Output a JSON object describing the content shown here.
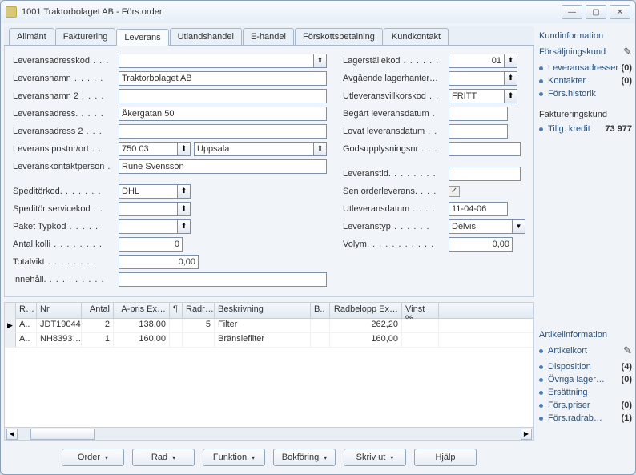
{
  "window": {
    "title": "1001 Traktorbolaget AB - Förs.order"
  },
  "tabs": [
    "Allmänt",
    "Fakturering",
    "Leverans",
    "Utlandshandel",
    "E-handel",
    "Förskottsbetalning",
    "Kundkontakt"
  ],
  "active_tab": 2,
  "left_fields": {
    "leveransadresskod": {
      "label": "Leveransadresskod",
      "value": ""
    },
    "leveransnamn": {
      "label": "Leveransnamn",
      "value": "Traktorbolaget AB"
    },
    "leveransnamn2": {
      "label": "Leveransnamn 2",
      "value": ""
    },
    "leveransadress": {
      "label": "Leveransadress.",
      "value": "Åkergatan 50"
    },
    "leveransadress2": {
      "label": "Leveransadress 2",
      "value": ""
    },
    "postnr": {
      "label": "Leverans postnr/ort",
      "value": "750 03"
    },
    "ort": {
      "value": "Uppsala"
    },
    "kontakt": {
      "label": "Leveranskontaktperson",
      "value": "Rune Svensson"
    },
    "speditor": {
      "label": "Speditörkod.",
      "value": "DHL"
    },
    "speditorservice": {
      "label": "Speditör servicekod",
      "value": ""
    },
    "pakettyp": {
      "label": "Paket Typkod",
      "value": ""
    },
    "antalkolli": {
      "label": "Antal kolli",
      "value": "0"
    },
    "totalvikt": {
      "label": "Totalvikt",
      "value": "0,00"
    },
    "innehall": {
      "label": "Innehåll.",
      "value": ""
    }
  },
  "right_fields": {
    "lagerstallekod": {
      "label": "Lagerställekod",
      "value": "01"
    },
    "avgaende": {
      "label": "Avgående lagerhanter…",
      "value": ""
    },
    "utleveransvillkor": {
      "label": "Utleveransvillkorskod",
      "value": "FRITT"
    },
    "begartdatum": {
      "label": "Begärt leveransdatum",
      "value": ""
    },
    "lovatdatum": {
      "label": "Lovat leveransdatum",
      "value": ""
    },
    "godsupplysning": {
      "label": "Godsupplysningsnr",
      "value": ""
    },
    "leveranstid": {
      "label": "Leveranstid.",
      "value": ""
    },
    "senorder": {
      "label": "Sen orderleverans.",
      "checked": true
    },
    "utleveransdatum": {
      "label": "Utleveransdatum",
      "value": "11-04-06"
    },
    "leveranstyp": {
      "label": "Leveranstyp",
      "value": "Delvis"
    },
    "volym": {
      "label": "Volym.",
      "value": "0,00"
    }
  },
  "grid": {
    "cols": [
      "R…",
      "Nr",
      "Antal",
      "A-pris Ex…",
      "¶",
      "Radr…",
      "Beskrivning",
      "B..",
      "Radbelopp Ex…",
      "Vinst %"
    ],
    "rows": [
      {
        "sel": "▶",
        "r": "A..",
        "nr": "JDT19044",
        "antal": "2",
        "apris": "138,00",
        "p": "",
        "radr": "5",
        "besk": "Filter",
        "b": "",
        "radbel": "262,20",
        "vinst": ""
      },
      {
        "sel": "",
        "r": "A..",
        "nr": "NH8393…",
        "antal": "1",
        "apris": "160,00",
        "p": "",
        "radr": "",
        "besk": "Bränslefilter",
        "b": "",
        "radbel": "160,00",
        "vinst": ""
      }
    ]
  },
  "footer": [
    "Order",
    "Rad",
    "Funktion",
    "Bokföring",
    "Skriv ut",
    "Hjälp"
  ],
  "kundinfo": {
    "title": "Kundinformation",
    "fk_title": "Försäljningskund",
    "items": [
      {
        "label": "Leveransadresser",
        "badge": "(0)"
      },
      {
        "label": "Kontakter",
        "badge": "(0)"
      },
      {
        "label": "Förs.historik",
        "badge": ""
      }
    ],
    "fakt_title": "Faktureringskund",
    "kredit_label": "Tillg. kredit",
    "kredit_value": "73 977"
  },
  "artikelinfo": {
    "title": "Artikelinformation",
    "ak_label": "Artikelkort",
    "items": [
      {
        "label": "Disposition",
        "badge": "(4)"
      },
      {
        "label": "Övriga lager…",
        "badge": "(0)"
      },
      {
        "label": "Ersättning",
        "badge": ""
      },
      {
        "label": "Förs.priser",
        "badge": "(0)"
      },
      {
        "label": "Förs.radrab…",
        "badge": "(1)"
      }
    ]
  }
}
